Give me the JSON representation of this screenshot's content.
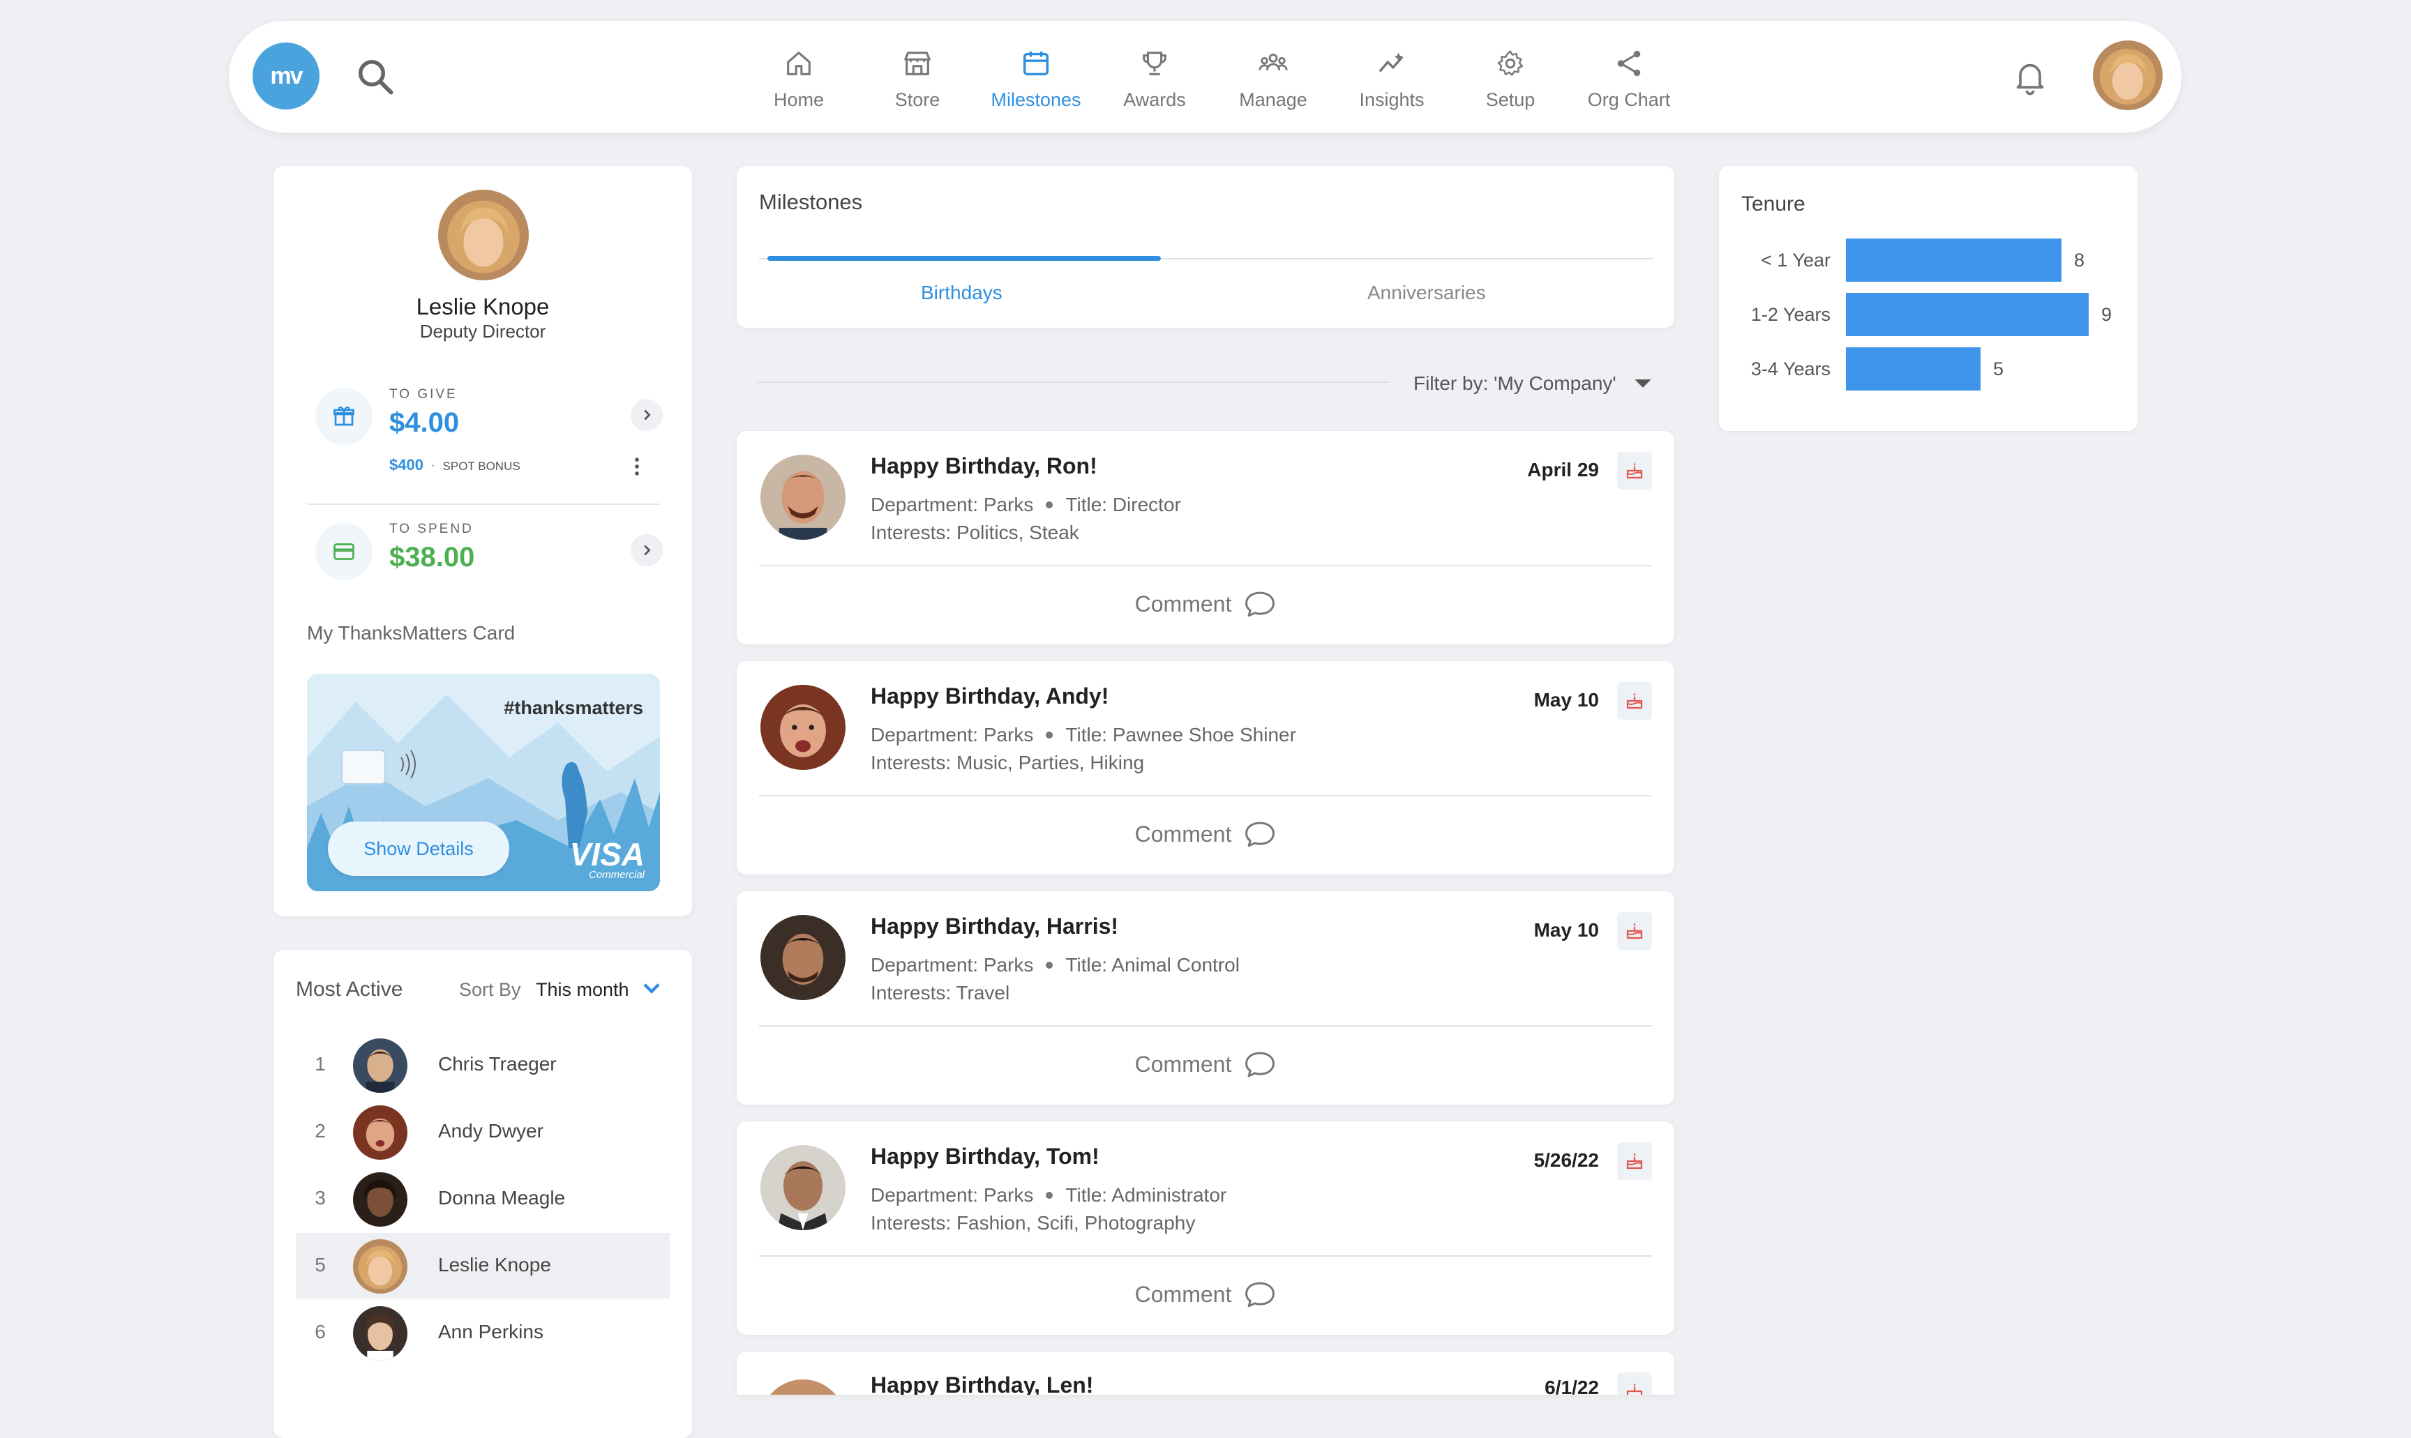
{
  "nav": {
    "logo": "mv",
    "items": [
      {
        "label": "Home",
        "icon": "home-icon"
      },
      {
        "label": "Store",
        "icon": "store-icon"
      },
      {
        "label": "Milestones",
        "icon": "calendar-icon",
        "active": true
      },
      {
        "label": "Awards",
        "icon": "trophy-icon"
      },
      {
        "label": "Manage",
        "icon": "people-icon"
      },
      {
        "label": "Insights",
        "icon": "insights-icon"
      },
      {
        "label": "Setup",
        "icon": "gear-icon"
      },
      {
        "label": "Org Chart",
        "icon": "share-icon"
      }
    ]
  },
  "profile": {
    "name": "Leslie Knope",
    "role": "Deputy Director",
    "to_give_label": "TO GIVE",
    "to_give_value": "$4.00",
    "spot_bonus_value": "$400",
    "spot_bonus_label": "SPOT BONUS",
    "to_spend_label": "TO SPEND",
    "to_spend_value": "$38.00",
    "card_title": "My ThanksMatters Card",
    "card_hashtag": "#thanksmatters",
    "show_details": "Show Details",
    "visa_brand": "VISA",
    "visa_sub": "Commercial"
  },
  "most_active": {
    "title": "Most Active",
    "sort_label": "Sort By",
    "sort_value": "This month",
    "rows": [
      {
        "rank": "1",
        "name": "Chris Traeger"
      },
      {
        "rank": "2",
        "name": "Andy Dwyer"
      },
      {
        "rank": "3",
        "name": "Donna Meagle"
      },
      {
        "rank": "5",
        "name": "Leslie Knope",
        "selected": true
      },
      {
        "rank": "6",
        "name": "Ann Perkins"
      }
    ]
  },
  "milestones": {
    "title": "Milestones",
    "tabs": [
      {
        "label": "Birthdays",
        "active": true
      },
      {
        "label": "Anniversaries"
      }
    ],
    "filter": "Filter by: 'My Company'",
    "comment_label": "Comment",
    "cards": [
      {
        "headline": "Happy Birthday, Ron!",
        "department": "Department: Parks",
        "title": "Title: Director",
        "interests": "Interests: Politics, Steak",
        "date": "April 29"
      },
      {
        "headline": "Happy Birthday, Andy!",
        "department": "Department: Parks",
        "title": "Title: Pawnee Shoe Shiner",
        "interests": "Interests: Music, Parties, Hiking",
        "date": "May 10"
      },
      {
        "headline": "Happy Birthday, Harris!",
        "department": "Department: Parks",
        "title": "Title: Animal Control",
        "interests": "Interests: Travel",
        "date": "May 10"
      },
      {
        "headline": "Happy Birthday, Tom!",
        "department": "Department: Parks",
        "title": "Title: Administrator",
        "interests": "Interests: Fashion, Scifi, Photography",
        "date": "5/26/22"
      },
      {
        "headline": "Happy Birthday, Len!",
        "department": "",
        "title": "",
        "interests": "",
        "date": "6/1/22"
      }
    ]
  },
  "tenure": {
    "title": "Tenure",
    "rows": [
      {
        "label": "< 1 Year",
        "value": 8
      },
      {
        "label": "1-2 Years",
        "value": 9
      },
      {
        "label": "3-4 Years",
        "value": 5
      }
    ]
  },
  "colors": {
    "accent": "#2e8fe0",
    "logo": "#4aa3dc",
    "bar": "#3f95ec",
    "money_green": "#4caf50",
    "cake_red": "#e2564f"
  }
}
